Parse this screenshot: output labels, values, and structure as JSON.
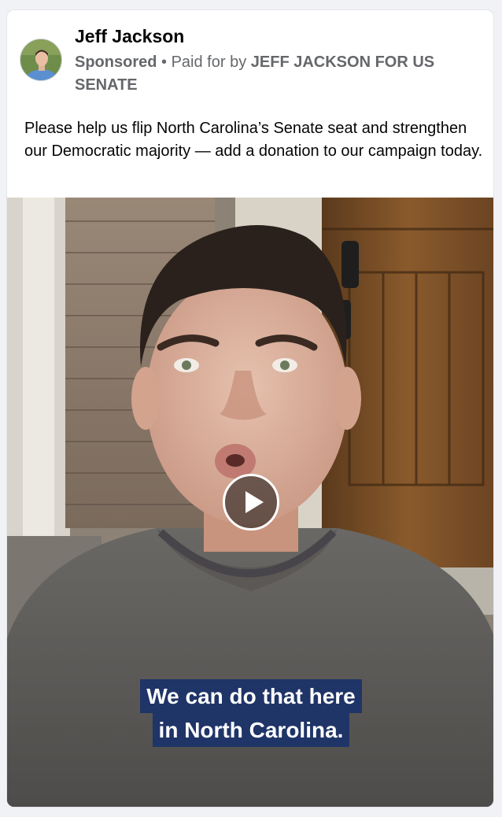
{
  "post": {
    "page_name": "Jeff Jackson",
    "sponsored_label": "Sponsored",
    "separator": "•",
    "paid_for_prefix": "Paid for by",
    "paid_for_name": "JEFF JACKSON FOR US SENATE",
    "message": "Please help us flip North Carolina’s Senate seat and strengthen our Democratic majority — add a donation to our campaign today."
  },
  "video": {
    "caption_line1": "We can do that here",
    "caption_line2": "in North Carolina.",
    "play_icon": "play-icon",
    "caption_color": "#1f3467"
  }
}
